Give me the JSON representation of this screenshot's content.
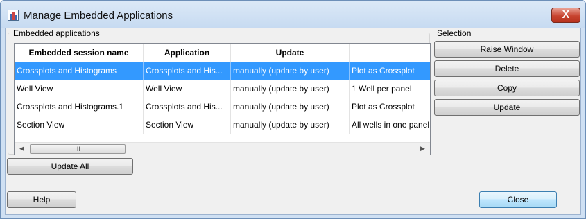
{
  "window": {
    "title": "Manage Embedded Applications",
    "title_icon": "app-chart-icon",
    "close_glyph": "X"
  },
  "embedded_group": {
    "label": "Embedded applications",
    "columns": [
      "Embedded session name",
      "Application",
      "Update",
      ""
    ],
    "rows": [
      {
        "name": "Crossplots and Histograms",
        "application": "Crossplots and His...",
        "update": "manually (update by user)",
        "extra": "Plot as Crossplot",
        "selected": true
      },
      {
        "name": "Well View",
        "application": "Well View",
        "update": "manually (update by user)",
        "extra": "1 Well per panel",
        "selected": false
      },
      {
        "name": "Crossplots and Histograms.1",
        "application": "Crossplots and His...",
        "update": "manually (update by user)",
        "extra": "Plot as Crossplot",
        "selected": false
      },
      {
        "name": "Section View",
        "application": "Section View",
        "update": "manually (update by user)",
        "extra": "All wells in one panel",
        "selected": false
      }
    ],
    "scroll_left_glyph": "◀",
    "scroll_right_glyph": "▶",
    "scroll_thumb_grip": "III",
    "update_all_label": "Update All"
  },
  "selection_group": {
    "label": "Selection",
    "buttons": [
      "Raise Window",
      "Delete",
      "Copy",
      "Update"
    ]
  },
  "footer": {
    "help_label": "Help",
    "close_label": "Close"
  },
  "colors": {
    "selection": "#3399ff",
    "frame": "#cfe0f3",
    "close_button": "#c7432f"
  }
}
